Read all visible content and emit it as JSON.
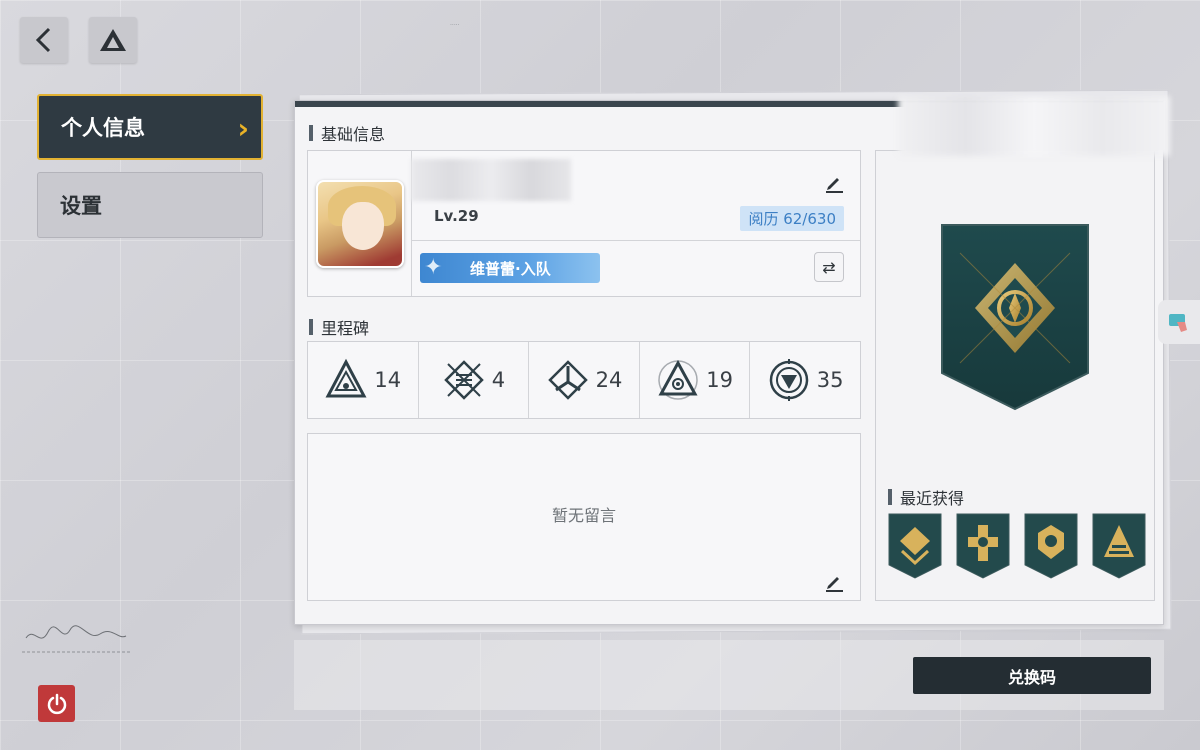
{
  "nav": {
    "back_icon": "chevron-left-icon",
    "drive_icon": "triangle-logo-icon",
    "items": [
      {
        "label": "个人信息",
        "active": true
      },
      {
        "label": "设置",
        "active": false
      }
    ],
    "power_icon": "power-icon"
  },
  "profile": {
    "section_title": "基础信息",
    "level": "Lv.29",
    "experience": "阅历 62/630",
    "team": "维普蕾·入队"
  },
  "milestones": {
    "section_title": "里程碑",
    "items": [
      {
        "icon": "triangle-emblem-icon",
        "value": "14"
      },
      {
        "icon": "crossed-swords-list-icon",
        "value": "4"
      },
      {
        "icon": "tri-branch-emblem-icon",
        "value": "24"
      },
      {
        "icon": "eye-triangle-emblem-icon",
        "value": "19"
      },
      {
        "icon": "target-triangle-emblem-icon",
        "value": "35"
      }
    ]
  },
  "messages": {
    "empty_text": "暂无留言"
  },
  "badges": {
    "recent_title": "最近获得",
    "recent": [
      {
        "icon": "chevron-badge-icon"
      },
      {
        "icon": "cross-badge-icon"
      },
      {
        "icon": "shield-badge-icon"
      },
      {
        "icon": "pyramid-badge-icon"
      }
    ]
  },
  "actions": {
    "redeem_label": "兑换码"
  },
  "colors": {
    "accent_gold": "#e2b233",
    "nav_active_bg": "#2f3a42",
    "exp_badge_bg": "#cfe3f7",
    "team_tag": "#3e87d1",
    "power": "#c0393a",
    "badge_teal": "#234a4c"
  }
}
